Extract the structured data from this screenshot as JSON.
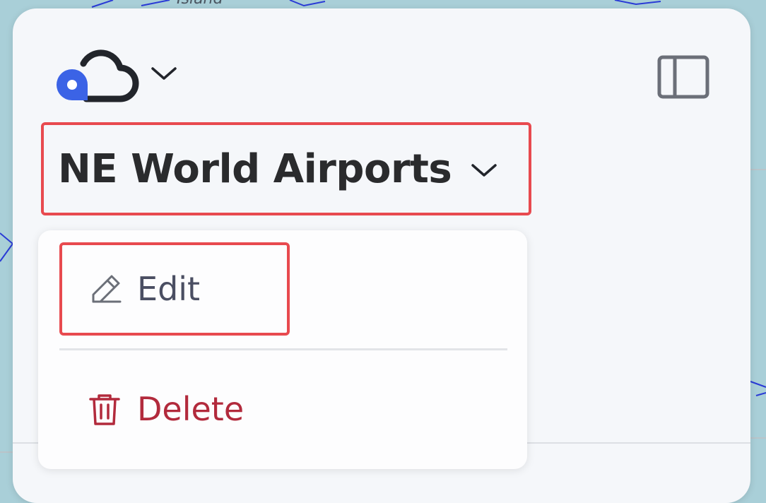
{
  "map_background": {
    "label": "Island"
  },
  "header": {
    "logo_icon": "cloud-map-pin-logo",
    "logo_menu_icon": "chevron-down-icon",
    "sidebar_toggle_icon": "sidebar-panel-icon"
  },
  "map_selector": {
    "title": "NE World Airports",
    "chevron_icon": "chevron-down-icon"
  },
  "dropdown": {
    "items": [
      {
        "label": "Edit",
        "icon": "pencil-icon"
      },
      {
        "label": "Delete",
        "icon": "trash-icon"
      }
    ]
  },
  "colors": {
    "accent_blue": "#3b63e6",
    "highlight_red": "#e84a4f",
    "delete_red": "#b22a3c",
    "text_dark": "#2a2b2d",
    "text_muted": "#4a4e62"
  }
}
